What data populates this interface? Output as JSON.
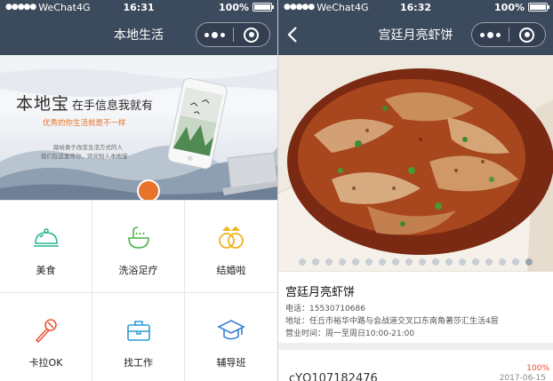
{
  "left": {
    "status": {
      "carrier": "WeChat4G",
      "time": "16:31",
      "battery": "100%",
      "battery_level": 1.0
    },
    "nav": {
      "title": "本地生活"
    },
    "banner": {
      "title_main": "本地宝",
      "title_sub": "在手信息我就有",
      "slogan": "优秀的你生活就是不一样",
      "line1": "献给勇于改变生活方式的人",
      "line2": "我们在这里等你，欢迎加入本地宝"
    },
    "grid": [
      {
        "label": "美食",
        "icon": "food-cloche-icon",
        "color": "#2cb392"
      },
      {
        "label": "洗浴足疗",
        "icon": "bath-icon",
        "color": "#49b44b"
      },
      {
        "label": "结婚啦",
        "icon": "rings-icon",
        "color": "#f2b21c"
      },
      {
        "label": "卡拉OK",
        "icon": "microphone-icon",
        "color": "#e8583a"
      },
      {
        "label": "找工作",
        "icon": "briefcase-icon",
        "color": "#2a9ed4"
      },
      {
        "label": "辅导班",
        "icon": "graduation-cap-icon",
        "color": "#3b7fd6"
      }
    ]
  },
  "right": {
    "status": {
      "carrier": "WeChat4G",
      "time": "16:32",
      "battery": "100%",
      "battery_level": 1.0
    },
    "nav": {
      "title": "宫廷月亮虾饼"
    },
    "carousel": {
      "count": 18,
      "active": 17
    },
    "shop": {
      "name": "宫廷月亮虾饼",
      "phone": "电话：15530710686",
      "address": "地址：任丘市裕华中路与会战道交叉口东南角著莎汇生活4层",
      "hours": "营业时间：周一至周日10:00-21:00"
    },
    "next_item": {
      "title": "cYQ107182476",
      "date": "2017-06-15"
    },
    "zoom": "100%"
  }
}
